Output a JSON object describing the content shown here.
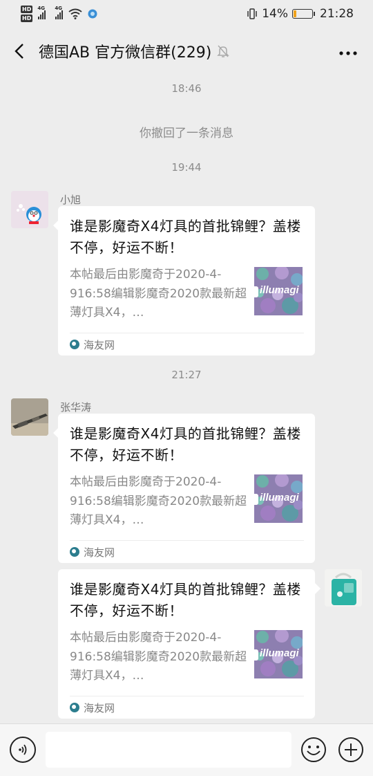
{
  "status_bar": {
    "network_left": "4G",
    "network_right": "4G",
    "hd_label": "HD",
    "battery_percent": "14%",
    "battery_level": 0.14,
    "time": "21:28"
  },
  "header": {
    "title": "德国AB  官方微信群(229)"
  },
  "timeline": {
    "time1": "18:46",
    "recall_notice": "你撤回了一条消息",
    "time2": "19:44",
    "time3": "21:27"
  },
  "messages": [
    {
      "sender": "小旭",
      "card_title": "谁是影魔奇X4灯具的首批锦鲤？盖楼不停，好运不断！",
      "card_desc": "本帖最后由影魔奇于2020-4-916:58编辑影魔奇2020款最新超薄灯具X4，…",
      "thumb_text": "illumagi",
      "source": "海友网"
    },
    {
      "sender": "张华涛",
      "card_title": "谁是影魔奇X4灯具的首批锦鲤？盖楼不停，好运不断！",
      "card_desc": "本帖最后由影魔奇于2020-4-916:58编辑影魔奇2020款最新超薄灯具X4，…",
      "thumb_text": "illumagi",
      "source": "海友网"
    },
    {
      "sender": "",
      "card_title": "谁是影魔奇X4灯具的首批锦鲤？盖楼不停，好运不断！",
      "card_desc": "本帖最后由影魔奇于2020-4-916:58编辑影魔奇2020款最新超薄灯具X4，…",
      "thumb_text": "illumagi",
      "source": "海友网"
    }
  ],
  "input_bar": {
    "placeholder": ""
  },
  "colors": {
    "background": "#ededed",
    "bubble": "#ffffff",
    "battery": "#f0a21b",
    "meta_text": "#8c8c8c"
  }
}
